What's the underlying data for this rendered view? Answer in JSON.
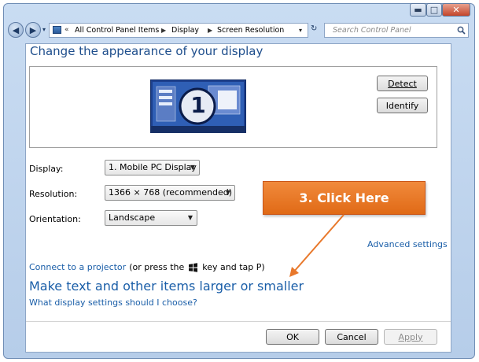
{
  "window": {
    "buttons": {
      "minimize": "▬",
      "maximize": "□",
      "close": "✕"
    }
  },
  "nav": {
    "breadcrumbs": [
      "All Control Panel Items",
      "Display",
      "Screen Resolution"
    ],
    "search_placeholder": "Search Control Panel"
  },
  "page": {
    "title": "Change the appearance of your display"
  },
  "preview": {
    "monitor_number": "1",
    "detect_label": "Detect",
    "identify_label": "Identify"
  },
  "settings": {
    "display_label": "Display:",
    "display_value": "1. Mobile PC Display",
    "resolution_label": "Resolution:",
    "resolution_value": "1366 × 768 (recommended)",
    "orientation_label": "Orientation:",
    "orientation_value": "Landscape"
  },
  "annotation": {
    "callout_text": "3. Click Here",
    "callout_color": "#ec7a2b"
  },
  "links": {
    "advanced_settings": "Advanced settings",
    "connect_projector": "Connect to a projector",
    "projector_hint_before": "(or press the",
    "projector_hint_after": "key and tap P)",
    "make_text_larger": "Make text and other items larger or smaller",
    "what_settings": "What display settings should I choose?"
  },
  "footer": {
    "ok_label": "OK",
    "cancel_label": "Cancel",
    "apply_label": "Apply"
  },
  "colors": {
    "link": "#1a5ea8",
    "title": "#1e4e8c",
    "accent_orange": "#e8782b"
  }
}
